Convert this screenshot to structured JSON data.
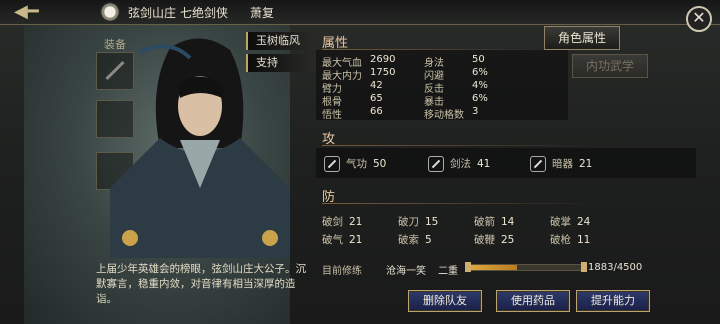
{
  "header": {
    "faction": "弦剑山庄",
    "title_rank": "七绝剑侠",
    "name": "萧复"
  },
  "left": {
    "equip_label": "装备",
    "tags": [
      "玉树临风",
      "支持"
    ],
    "bio": "上届少年英雄会的榜眼，弦剑山庄大公子。沉默寡言，稳重内敛，对音律有相当深厚的造诣。"
  },
  "tabs": {
    "role_attr": "角色属性",
    "internal_skill": "内功武学"
  },
  "attributes": {
    "title": "属性",
    "left_col": [
      {
        "label": "最大气血",
        "value": "2690"
      },
      {
        "label": "最大内力",
        "value": "1750"
      },
      {
        "label": "臂力",
        "value": "42"
      },
      {
        "label": "根骨",
        "value": "65"
      },
      {
        "label": "悟性",
        "value": "66"
      }
    ],
    "right_col": [
      {
        "label": "身法",
        "value": "50"
      },
      {
        "label": "闪避",
        "value": "6%"
      },
      {
        "label": "反击",
        "value": "4%"
      },
      {
        "label": "暴击",
        "value": "6%"
      },
      {
        "label": "移动格数",
        "value": "3"
      }
    ]
  },
  "attack": {
    "title": "攻",
    "items": [
      {
        "label": "气功",
        "value": "50",
        "icon": "qigong-icon"
      },
      {
        "label": "剑法",
        "value": "41",
        "icon": "sword-icon"
      },
      {
        "label": "暗器",
        "value": "21",
        "icon": "dart-icon"
      }
    ]
  },
  "defense": {
    "title": "防",
    "items": [
      {
        "label": "破剑",
        "value": "21"
      },
      {
        "label": "破刀",
        "value": "15"
      },
      {
        "label": "破箭",
        "value": "14"
      },
      {
        "label": "破掌",
        "value": "24"
      },
      {
        "label": "破气",
        "value": "21"
      },
      {
        "label": "破索",
        "value": "5"
      },
      {
        "label": "破鞭",
        "value": "25"
      },
      {
        "label": "破枪",
        "value": "11"
      }
    ]
  },
  "progress": {
    "label": "目前修练",
    "skill": "沧海一笑",
    "level": "二重",
    "value": "1883/4500",
    "fraction": 0.418
  },
  "actions": {
    "remove": "删除队友",
    "use_item": "使用药品",
    "improve": "提升能力"
  },
  "colors": {
    "accent_gold": "#b9a66a",
    "button_blue": "#1a2048",
    "progress_fill": "#e0a940"
  }
}
